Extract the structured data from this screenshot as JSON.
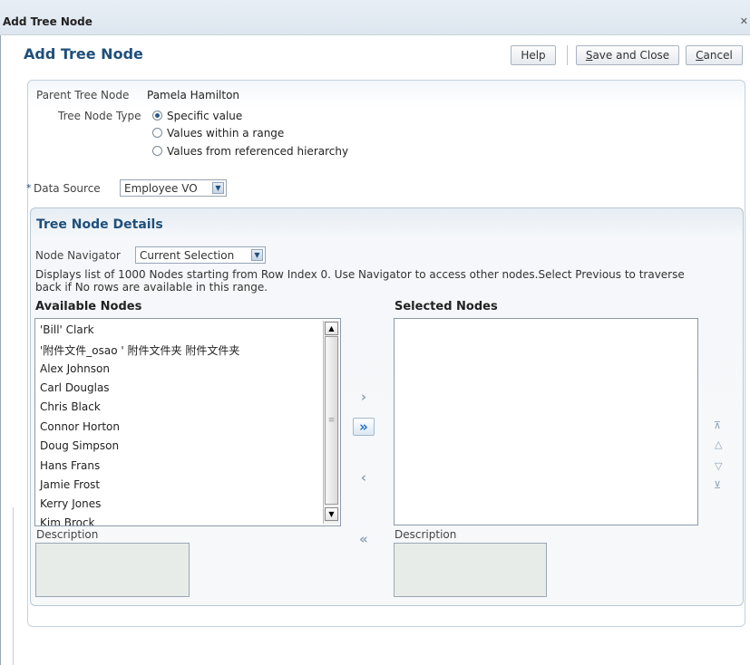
{
  "dialog": {
    "title_bar": "Add Tree Node",
    "heading": "Add Tree Node",
    "close_icon": "close-icon",
    "buttons": {
      "help": "Help",
      "save_close_accel": "S",
      "save_close_rest": "ave and Close",
      "cancel_accel": "C",
      "cancel_rest": "ancel"
    }
  },
  "form": {
    "parent_label": "Parent Tree Node",
    "parent_value": "Pamela Hamilton",
    "type_label": "Tree Node Type",
    "type_options": [
      "Specific value",
      "Values within a range",
      "Values from referenced hierarchy"
    ],
    "type_selected": "Specific value",
    "required_mark": "*",
    "data_source_label": "Data Source",
    "data_source_value": "Employee VO"
  },
  "details": {
    "title": "Tree Node Details",
    "navigator_label": "Node Navigator",
    "navigator_value": "Current Selection",
    "info_text": "Displays list of 1000 Nodes starting from Row Index 0. Use Navigator to access other nodes.Select Previous to traverse back if No rows are available in this range.",
    "available_heading": "Available Nodes",
    "selected_heading": "Selected Nodes",
    "available_items": [
      "'Bill' Clark",
      "'附件文件_osao ' 附件文件夹 附件文件夹",
      "Alex Johnson",
      "Carl Douglas",
      "Chris Black",
      "Connor Horton",
      "Doug Simpson",
      "Hans Frans",
      "Jamie Frost",
      "Kerry Jones",
      "Kim Brock"
    ],
    "description_label": "Description",
    "selected_description_label": "Description"
  },
  "icons": {
    "move": "chevron-right-icon",
    "move_all": "double-chevron-right-icon",
    "remove": "chevron-left-icon",
    "remove_all": "double-chevron-left-icon",
    "move_top": "move-top-icon",
    "move_up": "move-up-icon",
    "move_down": "move-down-icon",
    "move_bottom": "move-bottom-icon"
  },
  "colors": {
    "heading": "#1f4f7a",
    "active_shuttle": "#1e6fbf",
    "disabled_shuttle": "#8da2b6"
  }
}
